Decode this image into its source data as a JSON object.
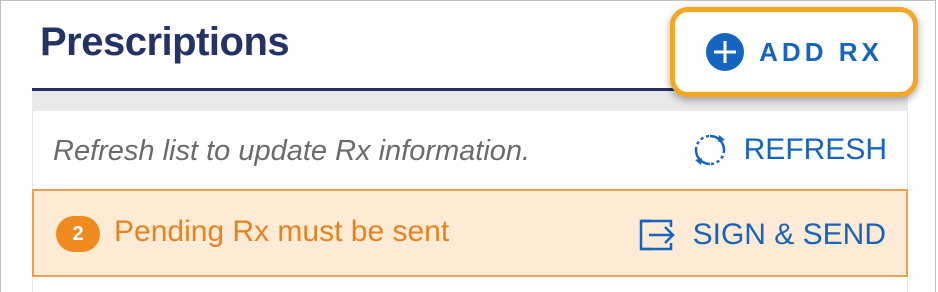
{
  "header": {
    "title": "Prescriptions",
    "add_button_label": "ADD RX",
    "add_icon": "plus-circle-icon"
  },
  "refresh_bar": {
    "message": "Refresh list to update Rx information.",
    "button_label": "REFRESH",
    "icon": "refresh-icon"
  },
  "pending_bar": {
    "count": "2",
    "message": "Pending Rx must be sent",
    "button_label": "SIGN & SEND",
    "icon": "send-arrow-icon"
  },
  "colors": {
    "title": "#243366",
    "link": "#1565c0",
    "highlight": "#f5a623",
    "pending_bg": "#fdebd5",
    "pending_text": "#e8821e"
  }
}
